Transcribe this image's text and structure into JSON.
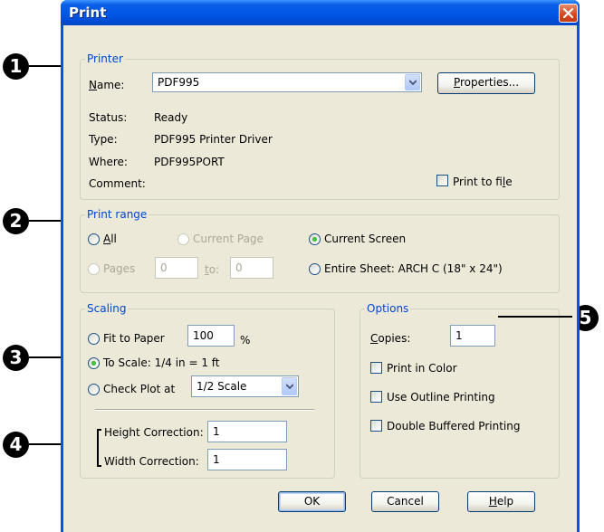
{
  "window": {
    "title": "Print"
  },
  "callouts": [
    "1",
    "2",
    "3",
    "4",
    "5"
  ],
  "printer": {
    "legend": "Printer",
    "name_label_u": "N",
    "name_label_rest": "ame:",
    "name_value": "PDF995",
    "properties_u": "P",
    "properties_rest": "roperties...",
    "status_label": "Status:",
    "status_value": "Ready",
    "type_label": "Type:",
    "type_value": "PDF995 Printer Driver",
    "where_label": "Where:",
    "where_value": "PDF995PORT",
    "comment_label": "Comment:",
    "print_to_file_pre": "Print to fi",
    "print_to_file_u": "l",
    "print_to_file_post": "e"
  },
  "print_range": {
    "legend": "Print range",
    "all_u": "A",
    "all_rest": "ll",
    "current_page": "Current Page",
    "current_screen": "Current Screen",
    "pages": "Pages",
    "pages_from": "0",
    "to_u": "t",
    "to_rest": "o:",
    "pages_to": "0",
    "entire_sheet": "Entire Sheet: ARCH C  (18\" x 24\")",
    "selected": "Current Screen"
  },
  "scaling": {
    "legend": "Scaling",
    "fit_to_paper": "Fit to Paper",
    "fit_value": "100",
    "percent": "%",
    "to_scale": "To Scale: 1/4 in = 1 ft",
    "check_plot_at": "Check Plot at",
    "check_plot_value": "1/2 Scale",
    "selected": "To Scale: 1/4 in = 1 ft",
    "height_correction_label": "Height Correction:",
    "height_correction_value": "1",
    "width_correction_label": "Width Correction:",
    "width_correction_value": "1"
  },
  "options": {
    "legend": "Options",
    "copies_u": "C",
    "copies_rest": "opies:",
    "copies_value": "1",
    "print_in_color": "Print in Color",
    "use_outline_printing": "Use Outline Printing",
    "double_buffered_printing": "Double Buffered Printing"
  },
  "buttons": {
    "ok": "OK",
    "cancel": "Cancel",
    "help_u": "H",
    "help_rest": "elp"
  }
}
